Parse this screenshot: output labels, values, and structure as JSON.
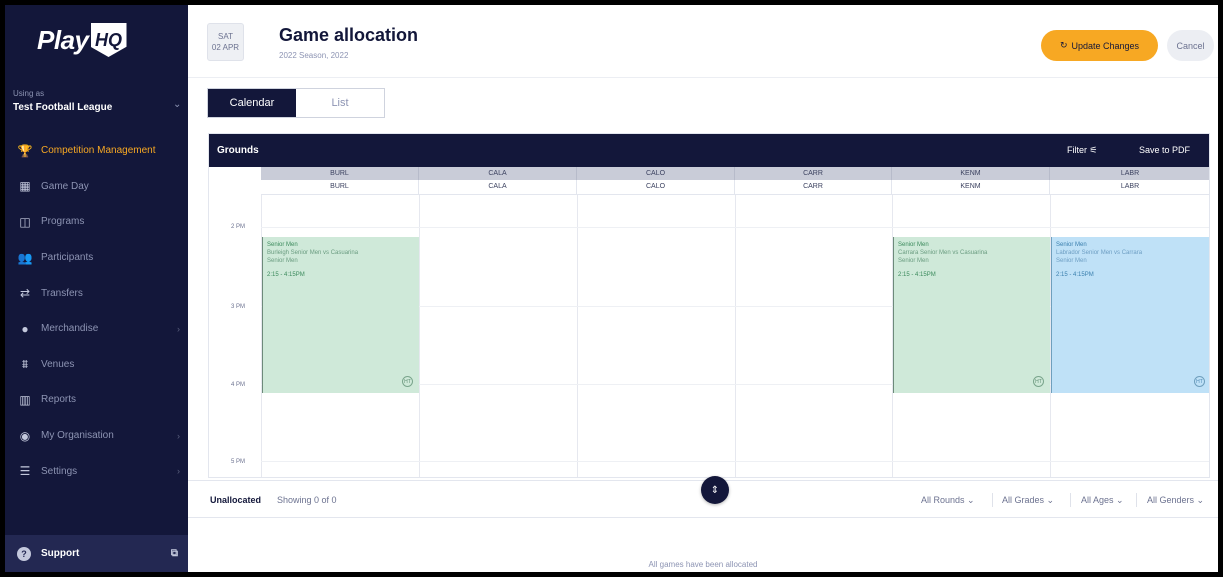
{
  "app": {
    "logo_play": "Play",
    "logo_hq": "HQ"
  },
  "org": {
    "label": "Using as",
    "name": "Test Football League"
  },
  "sidebar": {
    "items": [
      {
        "label": "Competition Management",
        "icon": "trophy-icon",
        "active": true
      },
      {
        "label": "Game Day",
        "icon": "scoreboard-icon"
      },
      {
        "label": "Programs",
        "icon": "programs-icon"
      },
      {
        "label": "Participants",
        "icon": "participants-icon"
      },
      {
        "label": "Transfers",
        "icon": "transfer-icon"
      },
      {
        "label": "Merchandise",
        "icon": "merchandise-icon",
        "caret": true
      },
      {
        "label": "Venues",
        "icon": "venue-icon"
      },
      {
        "label": "Reports",
        "icon": "reports-icon"
      },
      {
        "label": "My Organisation",
        "icon": "organisation-icon",
        "caret": true
      },
      {
        "label": "Settings",
        "icon": "settings-icon",
        "caret": true
      }
    ],
    "support": "Support"
  },
  "header": {
    "date_day": "SAT",
    "date_num": "02 APR",
    "title": "Game allocation",
    "subtitle": "2022 Season, 2022",
    "update_label": "Update Changes",
    "cancel_label": "Cancel"
  },
  "tabs": {
    "calendar": "Calendar",
    "list": "List"
  },
  "calendar": {
    "title": "Grounds",
    "filter": "Filter",
    "save_pdf": "Save to PDF",
    "columns": [
      {
        "code": "BURL",
        "sub": "BURL"
      },
      {
        "code": "CALA",
        "sub": "CALA"
      },
      {
        "code": "CALO",
        "sub": "CALO"
      },
      {
        "code": "CARR",
        "sub": "CARR"
      },
      {
        "code": "KENM",
        "sub": "KENM"
      },
      {
        "code": "LABR",
        "sub": "LABR"
      }
    ],
    "hours": [
      "2 PM",
      "3 PM",
      "4 PM",
      "5 PM"
    ],
    "games": [
      {
        "title": "Senior Men",
        "match": "Burleigh Senior Men vs Casuarina",
        "grade": "Senior Men",
        "time": "2:15 - 4:15PM",
        "badge": "HT"
      },
      {
        "title": "Senior Men",
        "match": "Carrara Senior Men vs Casuarina",
        "grade": "Senior Men",
        "time": "2:15 - 4:15PM",
        "badge": "HT"
      },
      {
        "title": "Senior Men",
        "match": "Labrador Senior Men vs Carrara",
        "grade": "Senior Men",
        "time": "2:15 - 4:15PM",
        "badge": "HT"
      }
    ],
    "colors": {
      "green": "#cfe9d9",
      "blue": "#bfe1f7",
      "navy": "#13173a",
      "accent": "#f7a823"
    }
  },
  "unallocated": {
    "label": "Unallocated",
    "count": "Showing 0 of 0",
    "filters": [
      "All Rounds",
      "All Grades",
      "All Ages",
      "All Genders"
    ],
    "empty": "All games have been allocated"
  }
}
